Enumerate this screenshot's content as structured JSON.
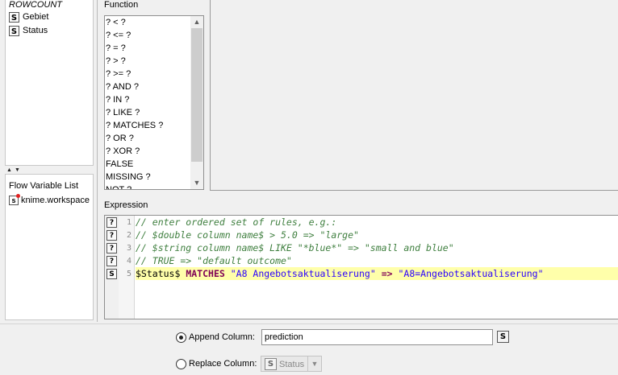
{
  "column_list": {
    "items": [
      {
        "label": "ROWCOUNT",
        "type": "none"
      },
      {
        "label": "Gebiet",
        "type": "S"
      },
      {
        "label": "Status",
        "type": "S"
      }
    ]
  },
  "flow_variables": {
    "title": "Flow Variable List",
    "items": [
      {
        "label": "knime.workspace",
        "type": "s"
      }
    ]
  },
  "function_panel": {
    "title": "Function",
    "items": [
      "? < ?",
      "? <= ?",
      "? = ?",
      "? > ?",
      "? >= ?",
      "? AND ?",
      "? IN ?",
      "? LIKE ?",
      "? MATCHES ?",
      "? OR ?",
      "? XOR ?",
      "FALSE",
      "MISSING ?",
      "NOT ?"
    ]
  },
  "expression": {
    "title": "Expression",
    "line_icons": [
      "?",
      "?",
      "?",
      "?",
      "S"
    ],
    "line_numbers": [
      "1",
      "2",
      "3",
      "4",
      "5"
    ],
    "lines": [
      "// enter ordered set of rules, e.g.:",
      "// $double column name$ > 5.0 => \"large\"",
      "// $string column name$ LIKE \"*blue*\" => \"small and blue\"",
      "// TRUE => \"default outcome\""
    ],
    "rule": {
      "field": "$Status$",
      "keyword": "MATCHES",
      "pattern": "\"A8 Angebotsaktualiserung\"",
      "arrow": "=>",
      "outcome": "\"A8=Angebotsaktualiserung\""
    }
  },
  "output": {
    "append_label": "Append Column:",
    "append_value": "prediction",
    "append_selected": true,
    "append_type": "S",
    "replace_label": "Replace Column:",
    "replace_value": "Status",
    "replace_type": "S"
  }
}
